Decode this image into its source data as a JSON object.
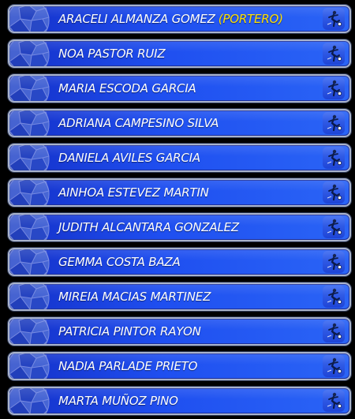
{
  "roster": {
    "players": [
      {
        "name": "ARACELI ALMANZA GOMEZ",
        "role": "(PORTERO)"
      },
      {
        "name": "NOA PASTOR RUIZ",
        "role": ""
      },
      {
        "name": "MARIA ESCODA GARCIA",
        "role": ""
      },
      {
        "name": "ADRIANA CAMPESINO SILVA",
        "role": ""
      },
      {
        "name": "DANIELA AVILES GARCIA",
        "role": ""
      },
      {
        "name": "AINHOA ESTEVEZ MARTIN",
        "role": ""
      },
      {
        "name": "JUDITH ALCANTARA GONZALEZ",
        "role": ""
      },
      {
        "name": "GEMMA COSTA BAZA",
        "role": ""
      },
      {
        "name": "MIREIA MACIAS MARTINEZ",
        "role": ""
      },
      {
        "name": "PATRICIA PINTOR RAYON",
        "role": ""
      },
      {
        "name": "NADIA PARLADE PRIETO",
        "role": ""
      },
      {
        "name": "MARTA MUÑOZ PINO",
        "role": ""
      }
    ],
    "row_icon": "soccer-player-kick-icon",
    "decor_icon": "soccer-ball-icon"
  },
  "colors": {
    "background": "#000000",
    "row_blue": "#1f4ff0",
    "row_border": "#a9b3cc",
    "text": "#ffffff",
    "role_highlight": "#ffe000"
  }
}
